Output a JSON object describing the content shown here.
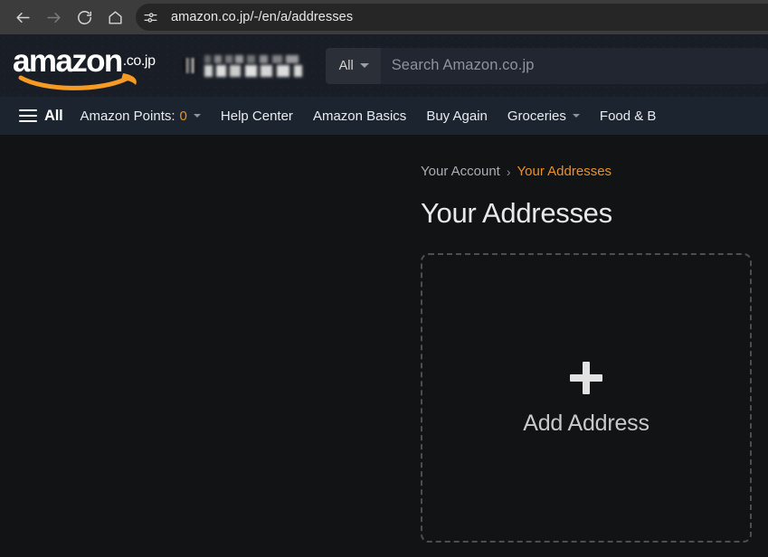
{
  "browser": {
    "back_icon": "back-arrow-icon",
    "forward_icon": "forward-arrow-icon",
    "reload_icon": "reload-icon",
    "home_icon": "home-icon",
    "site_settings_icon": "site-settings-sliders-icon",
    "url": "amazon.co.jp/-/en/a/addresses"
  },
  "header": {
    "logo_text": "amazon",
    "logo_tld": ".co.jp",
    "smile_color": "#f59a23",
    "location": {
      "icon": "location-pin-icon",
      "line1": "",
      "line2": "",
      "redacted": "blurred"
    },
    "search": {
      "category": "All",
      "category_caret": "chevron-down-icon",
      "placeholder": "Search Amazon.co.jp",
      "value": ""
    }
  },
  "nav": {
    "all_label": "All",
    "all_icon": "hamburger-menu-icon",
    "items": [
      {
        "label": "Amazon Points:",
        "value": "0",
        "caret": true
      },
      {
        "label": "Help Center",
        "caret": false
      },
      {
        "label": "Amazon Basics",
        "caret": false
      },
      {
        "label": "Buy Again",
        "caret": false
      },
      {
        "label": "Groceries",
        "caret": true
      },
      {
        "label": "Food & B",
        "caret": false
      }
    ]
  },
  "main": {
    "breadcrumb": {
      "parent": "Your Account",
      "separator": "›",
      "current": "Your Addresses"
    },
    "title": "Your Addresses",
    "add_card": {
      "plus_icon": "plus-icon",
      "label": "Add Address"
    }
  },
  "colors": {
    "accent_orange": "#e8912d",
    "browser_chrome": "#3c3c3c",
    "header_bg": "#191e26",
    "nav_bg": "#1c2430",
    "page_bg": "#111315"
  }
}
